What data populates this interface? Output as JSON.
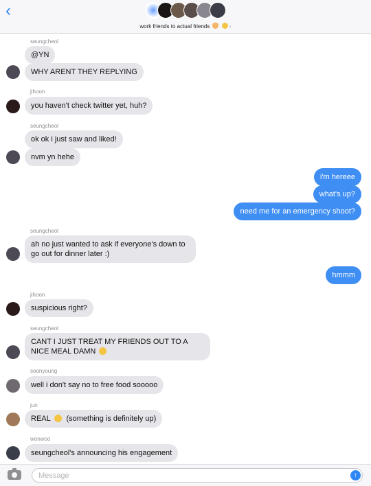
{
  "header": {
    "back_icon": "chevron-left-icon",
    "group_name": "work friends to actual friends",
    "group_emojis": [
      "hand-emoji",
      "smirk-emoji"
    ],
    "chevron": "›"
  },
  "messages": [
    {
      "sender": "seungcheol",
      "lines": [
        "@YN",
        "WHY ARENT THEY REPLYING"
      ]
    },
    {
      "sender": "jihoon",
      "lines": [
        "you haven't check twitter yet, huh?"
      ]
    },
    {
      "sender": "seungcheol",
      "lines": [
        "ok ok i just saw and liked!",
        "nvm yn hehe"
      ]
    },
    {
      "sender": "me",
      "lines": [
        "i'm hereee",
        "what's up?",
        "need me for an emergency shoot?"
      ]
    },
    {
      "sender": "seungcheol",
      "lines": [
        "ah no just wanted to ask if everyone's down to go out for dinner later :)"
      ]
    },
    {
      "sender": "me",
      "lines": [
        "hmmm"
      ]
    },
    {
      "sender": "jihoon",
      "lines": [
        "suspicious right?"
      ]
    },
    {
      "sender": "seungcheol",
      "lines": [
        "CANT I JUST TREAT MY FRIENDS OUT TO A NICE MEAL DAMN"
      ]
    },
    {
      "sender": "soonyoung",
      "lines": [
        "well i don't say no to free food sooooo"
      ]
    },
    {
      "sender": "jun",
      "lines": [
        "REAL",
        "(something is definitely up)"
      ]
    },
    {
      "sender": "wonwoo",
      "lines": [
        "seungcheol's announcing his engagement"
      ]
    }
  ],
  "composer": {
    "placeholder": "Message",
    "camera_icon": "camera-icon",
    "send_icon": "send-arrow-icon",
    "send_glyph": "↑"
  },
  "colors": {
    "accent": "#2f86f5",
    "outgoing_bubble": "#3f8ef3",
    "incoming_bubble": "#e5e5ea"
  }
}
